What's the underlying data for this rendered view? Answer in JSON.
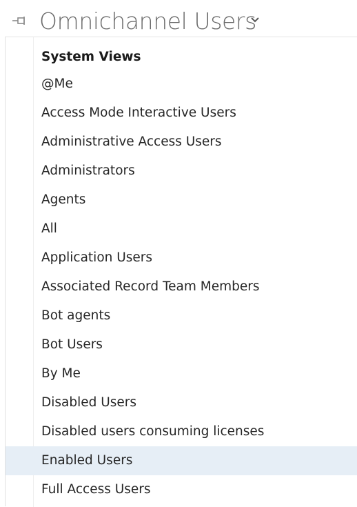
{
  "header": {
    "title": "Omnichannel Users",
    "pin_icon": "pin-icon",
    "dropdown_icon": "chevron-down-icon"
  },
  "flyout": {
    "group_heading": "System Views",
    "items": [
      {
        "label": "@Me"
      },
      {
        "label": "Access Mode Interactive Users"
      },
      {
        "label": "Administrative Access Users"
      },
      {
        "label": "Administrators"
      },
      {
        "label": "Agents"
      },
      {
        "label": "All"
      },
      {
        "label": "Application Users"
      },
      {
        "label": "Associated Record Team Members"
      },
      {
        "label": "Bot agents"
      },
      {
        "label": "Bot Users"
      },
      {
        "label": "By Me"
      },
      {
        "label": "Disabled Users"
      },
      {
        "label": "Disabled users consuming licenses"
      },
      {
        "label": "Enabled Users",
        "hover": true
      },
      {
        "label": "Full Access Users"
      }
    ]
  },
  "colors": {
    "hover_background": "#e6eef6",
    "title_text": "#6b6b6b",
    "item_text": "#262626"
  }
}
